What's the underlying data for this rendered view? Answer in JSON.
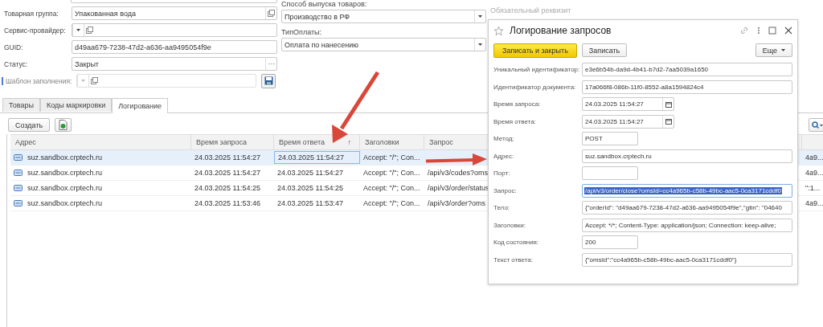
{
  "form": {
    "left_fields": [
      {
        "label": "Товарная группа:",
        "value": "Упакованная вода",
        "kind": "open",
        "disabled": false
      },
      {
        "label": "Сервис-провайдер:",
        "kind": "select_open",
        "disabled": false
      },
      {
        "label": "GUID:",
        "value": "d49aa679-7238-47d2-a636-aa9495054f9e",
        "kind": "text",
        "disabled": false
      },
      {
        "label": "Статус:",
        "value": "Закрыт",
        "kind": "choice",
        "disabled": false
      },
      {
        "label": "Шаблон заполнения:",
        "kind": "select_open_save",
        "disabled": true
      }
    ],
    "right_fields": [
      {
        "label": "Способ выпуска товаров:",
        "value": "Производство в РФ"
      },
      {
        "label": "ТипОплаты:",
        "value": "Оплата по нанесению"
      }
    ],
    "required_note": "Обязательный реквизит"
  },
  "tabs": [
    {
      "label": "Товары",
      "selected": false
    },
    {
      "label": "Коды маркировки",
      "selected": false
    },
    {
      "label": "Логирование",
      "selected": true
    }
  ],
  "toolbar": {
    "create": "Создать"
  },
  "table": {
    "columns": [
      {
        "label": "Адрес"
      },
      {
        "label": "Время запроса"
      },
      {
        "label": "Время ответа",
        "sort_mark": "↑"
      },
      {
        "label": "Заголовки"
      },
      {
        "label": "Запрос"
      },
      {}
    ],
    "rows": [
      {
        "selected": true,
        "cells": [
          "suz.sandbox.crptech.ru",
          "24.03.2025 11:54:27",
          "24.03.2025 11:54:27",
          "Accept: \"/\"; Con...",
          null,
          "4a9..."
        ]
      },
      {
        "selected": false,
        "cells": [
          "suz.sandbox.crptech.ru",
          "24.03.2025 11:54:27",
          "24.03.2025 11:54:27",
          "Accept: \"/\"; Con...",
          "/api/v3/codes?oms",
          "4a9..."
        ]
      },
      {
        "selected": false,
        "cells": [
          "suz.sandbox.crptech.ru",
          "24.03.2025 11:54:25",
          "24.03.2025 11:54:25",
          "Accept: \"/\"; Con...",
          "/api/v3/order/status",
          "\":1..."
        ]
      },
      {
        "selected": false,
        "cells": [
          "suz.sandbox.crptech.ru",
          "24.03.2025 11:53:46",
          "24.03.2025 11:53:47",
          "Accept: \"/\"; Con...",
          "/api/v3/order?oms",
          "4a9..."
        ]
      }
    ]
  },
  "dialog": {
    "title": "Логирование запросов",
    "primary_button": "Записать и закрыть",
    "button": "Записать",
    "more_button": "Еще",
    "fields": [
      {
        "label": "Уникальный идентификатор:",
        "value": "e3e6b54b-da9d-4b41-b7d2-7aa5039a1650",
        "kind": "wide"
      },
      {
        "label": "Идентификатор документа:",
        "value": "17a066f8-086b-11f0-8552-a8a1594824c4",
        "kind": "wide"
      },
      {
        "label": "Время запроса:",
        "value": "24.03.2025 11:54:27",
        "kind": "date"
      },
      {
        "label": "Время ответа:",
        "value": "24.03.2025 11:54:27",
        "kind": "date"
      },
      {
        "label": "Метод:",
        "value": "POST",
        "kind": "short"
      },
      {
        "label": "Адрес:",
        "value": "suz.sandbox.crptech.ru",
        "kind": "wide"
      },
      {
        "label": "Порт:",
        "kind": "short"
      },
      {
        "label": "Запрос:",
        "value": "/api/v3/order/close?omsId=cc4a965b-c58b-49bc-aac5-0ca3171cddf0",
        "kind": "wide",
        "selected": true
      },
      {
        "label": "Тело:",
        "value": "{\"orderId\": \"d49aa679-7238-47d2-a636-aa9495054f9e\",\"gtin\": \"04640",
        "kind": "wide"
      },
      {
        "label": "Заголовки:",
        "value": "Accept: */*; Content-Type: application/json; Connection: keep-alive;",
        "kind": "wide"
      },
      {
        "label": "Код состояния:",
        "value": "200",
        "kind": "short"
      },
      {
        "label": "Текст ответа:",
        "value": "{\"omsId\":\"cc4a965b-c58b-49bc-aac5-0ca3171cddf0\"}",
        "kind": "wide"
      }
    ]
  }
}
